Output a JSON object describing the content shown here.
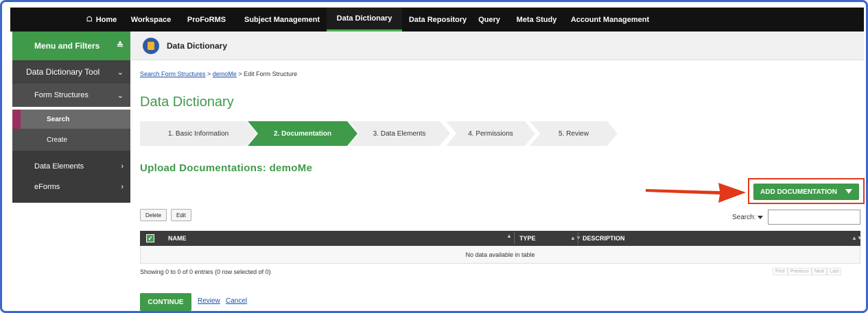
{
  "topnav": {
    "home": "Home",
    "items": [
      "Workspace",
      "ProFoRMS",
      "Subject Management",
      "Data Dictionary",
      "Data Repository",
      "Query",
      "Meta Study",
      "Account Management"
    ],
    "active": "Data Dictionary"
  },
  "sidebar": {
    "header": "Menu and Filters",
    "tool": "Data Dictionary Tool",
    "form_structures": "Form Structures",
    "search": "Search",
    "create": "Create",
    "data_elements": "Data Elements",
    "eforms": "eForms"
  },
  "page_header": {
    "title": "Data Dictionary"
  },
  "breadcrumb": {
    "link1": "Search Form Structures",
    "sep1": " > ",
    "link2": "demoMe",
    "rest": " > Edit Form Structure"
  },
  "main_title": "Data Dictionary",
  "steps": [
    "1. Basic Information",
    "2. Documentation",
    "3. Data Elements",
    "4. Permissions",
    "5. Review"
  ],
  "active_step": 1,
  "section_title": "Upload Documentations: demoMe",
  "add_button": "ADD DOCUMENTATION",
  "toolbar": {
    "delete": "Delete",
    "edit": "Edit"
  },
  "search": {
    "label": "Search:",
    "value": ""
  },
  "table": {
    "columns": [
      "NAME",
      "TYPE",
      "DESCRIPTION"
    ],
    "empty": "No data available in table",
    "info": "Showing 0 to 0 of 0 entries (0 row selected of 0)",
    "pager": [
      "First",
      "Previous",
      "Next",
      "Last"
    ]
  },
  "footer": {
    "continue": "CONTINUE",
    "review": "Review",
    "cancel": "Cancel"
  },
  "colors": {
    "green": "#3f9a4a",
    "nav": "#121212",
    "highlight": "#e0391a",
    "frame": "#3b67c9"
  }
}
